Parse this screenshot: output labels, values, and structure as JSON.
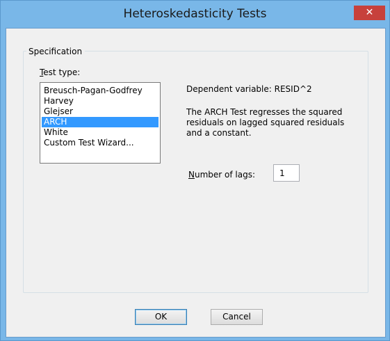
{
  "window": {
    "title": "Heteroskedasticity Tests",
    "close_glyph": "✕"
  },
  "specification": {
    "group_label": "Specification",
    "test_type_label_first": "T",
    "test_type_label_rest": "est type:",
    "test_types": [
      "Breusch-Pagan-Godfrey",
      "Harvey",
      "Glejser",
      "ARCH",
      "White",
      "Custom Test Wizard..."
    ],
    "selected_test": "ARCH",
    "dependent_variable": "Dependent variable: RESID^2",
    "description_lines": [
      "The ARCH Test regresses the squared",
      "residuals on lagged squared residuals",
      "and a constant."
    ],
    "lags_label_first": "N",
    "lags_label_rest": "umber of lags:",
    "lags_value": "1"
  },
  "buttons": {
    "ok": "OK",
    "cancel": "Cancel"
  },
  "colors": {
    "title_bar": "#79b7e8",
    "close_button": "#c7413c",
    "selection": "#3399ff",
    "dialog_background": "#f0f0f0"
  }
}
